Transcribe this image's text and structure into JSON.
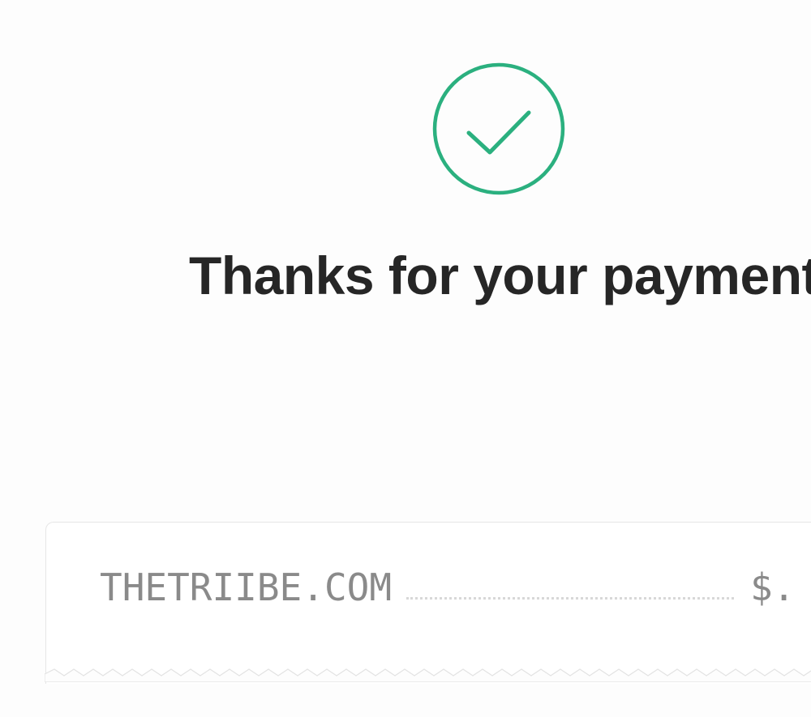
{
  "status": {
    "icon": "check-circle-icon",
    "accent_color": "#2bb07f"
  },
  "heading": {
    "text": "Thanks for your payment"
  },
  "receipt": {
    "merchant": "THETRIIBE.COM",
    "amount": "$."
  }
}
